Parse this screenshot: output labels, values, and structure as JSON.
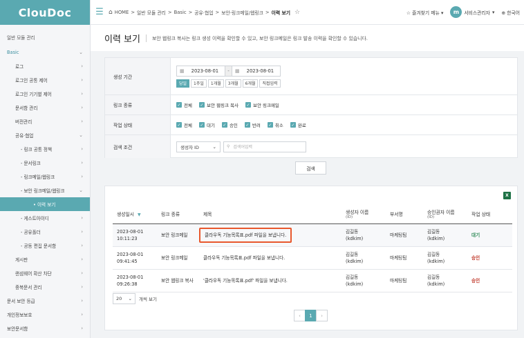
{
  "logo": "ClouDoc",
  "sidebar": {
    "items": [
      {
        "label": "일반 모듈 관리",
        "indent": 10,
        "chev": "",
        "cls": "section"
      },
      {
        "label": "Basic",
        "indent": 10,
        "chev": "⌄",
        "cls": "active"
      },
      {
        "label": "로그",
        "indent": 22,
        "chev": "›",
        "cls": ""
      },
      {
        "label": "로그인 공통 제어",
        "indent": 22,
        "chev": "›",
        "cls": ""
      },
      {
        "label": "로그인 기기별 제어",
        "indent": 22,
        "chev": "›",
        "cls": ""
      },
      {
        "label": "문서함 관리",
        "indent": 22,
        "chev": "›",
        "cls": ""
      },
      {
        "label": "버전관리",
        "indent": 22,
        "chev": "›",
        "cls": ""
      },
      {
        "label": "공유·협업",
        "indent": 22,
        "chev": "⌄",
        "cls": ""
      },
      {
        "label": "- 링크 공통 정책",
        "indent": 30,
        "chev": "›",
        "cls": ""
      },
      {
        "label": "- 문서링크",
        "indent": 30,
        "chev": "›",
        "cls": ""
      },
      {
        "label": "- 링크메일/웹링크",
        "indent": 30,
        "chev": "›",
        "cls": ""
      },
      {
        "label": "- 보안 링크메일/웹링크",
        "indent": 30,
        "chev": "⌄",
        "cls": ""
      },
      {
        "label": "• 이력 보기",
        "indent": 48,
        "chev": "",
        "cls": "current"
      },
      {
        "label": "- 게스트아이디",
        "indent": 30,
        "chev": "›",
        "cls": ""
      },
      {
        "label": "- 공유폴더",
        "indent": 30,
        "chev": "›",
        "cls": ""
      },
      {
        "label": "- 공동 편집 문서함",
        "indent": 30,
        "chev": "›",
        "cls": ""
      },
      {
        "label": "게시판",
        "indent": 22,
        "chev": "›",
        "cls": ""
      },
      {
        "label": "랜섬웨어 확산 차단",
        "indent": 22,
        "chev": "›",
        "cls": ""
      },
      {
        "label": "중복문서 관리",
        "indent": 22,
        "chev": "›",
        "cls": ""
      },
      {
        "label": "문서 보안 등급",
        "indent": 10,
        "chev": "›",
        "cls": ""
      },
      {
        "label": "개인정보보호",
        "indent": 10,
        "chev": "›",
        "cls": ""
      },
      {
        "label": "보안문서함",
        "indent": 10,
        "chev": "›",
        "cls": ""
      }
    ]
  },
  "topbar": {
    "crumbs": [
      "HOME",
      "일반 모듈 관리",
      "Basic",
      "공유·협업",
      "보안·링크메일/웹링크"
    ],
    "crumb_current": "이력 보기",
    "favorites": "즐겨찾기 메뉴",
    "avatar_letter": "m",
    "user": "서비스관리자",
    "lang": "한국어"
  },
  "page": {
    "title": "이력 보기",
    "desc": "보안 웹링크 복사는 링크 생성 이력을 확인할 수 있고, 보안 링크메일은 링크 발송 이력을 확인할 수 있습니다."
  },
  "filter": {
    "period_label": "생성 기간",
    "date_from": "2023-08-01",
    "date_to": "2023-08-01",
    "quick": [
      {
        "label": "당일",
        "on": true
      },
      {
        "label": "1주일",
        "on": false
      },
      {
        "label": "1개월",
        "on": false
      },
      {
        "label": "3개월",
        "on": false
      },
      {
        "label": "6개월",
        "on": false
      },
      {
        "label": "직접입력",
        "on": false
      }
    ],
    "linktype_label": "링크 종류",
    "linktypes": [
      "전체",
      "보안 웹링크 복사",
      "보안 링크메일"
    ],
    "status_label": "작업 상태",
    "statuses": [
      "전체",
      "대기",
      "승인",
      "반려",
      "취소",
      "완료"
    ],
    "cond_label": "검색 조건",
    "cond_select": "생성자 ID",
    "cond_placeholder": "검색어입력",
    "search_button": "검색"
  },
  "table": {
    "headers": [
      {
        "label": "생성일시",
        "sub": ""
      },
      {
        "label": "링크 종류",
        "sub": ""
      },
      {
        "label": "제목",
        "sub": ""
      },
      {
        "label": "생성자 이름",
        "sub": "(ID)"
      },
      {
        "label": "부서명",
        "sub": ""
      },
      {
        "label": "승인권자 이름",
        "sub": "(ID)"
      },
      {
        "label": "작업 상태",
        "sub": ""
      }
    ],
    "rows": [
      {
        "date": "2023-08-01",
        "time": "10:11:23",
        "type": "보안 링크메일",
        "title": "클라우독 기능목록표.pdf 파일을 보냅니다.",
        "creator": "김길동",
        "creator_id": "(kdkim)",
        "dept": "마케팅팀",
        "approver": "김길동",
        "approver_id": "(kdkim)",
        "status": "대기",
        "status_cls": "st-wait",
        "hl": true
      },
      {
        "date": "2023-08-01",
        "time": "09:41:45",
        "type": "보안 링크메일",
        "title": "클라우독 기능목록표.pdf 파일을 보냅니다.",
        "creator": "김길동",
        "creator_id": "(kdkim)",
        "dept": "마케팅팀",
        "approver": "김길동",
        "approver_id": "(kdkim)",
        "status": "승인",
        "status_cls": "st-ok",
        "hl": false
      },
      {
        "date": "2023-08-01",
        "time": "09:26:38",
        "type": "보안 웹링크 복사",
        "title": "'클라우독 기능목록표.pdf' 파일을 보냅니다.",
        "creator": "김길동",
        "creator_id": "(kdkim)",
        "dept": "마케팅팀",
        "approver": "김길동",
        "approver_id": "(kdkim)",
        "status": "승인",
        "status_cls": "st-ok",
        "hl": false
      }
    ],
    "page_size": "20",
    "page_size_suffix": "개씩 보기",
    "current_page": "1"
  },
  "colors": {
    "accent": "#5aa9b1",
    "highlight": "#e8572c"
  }
}
